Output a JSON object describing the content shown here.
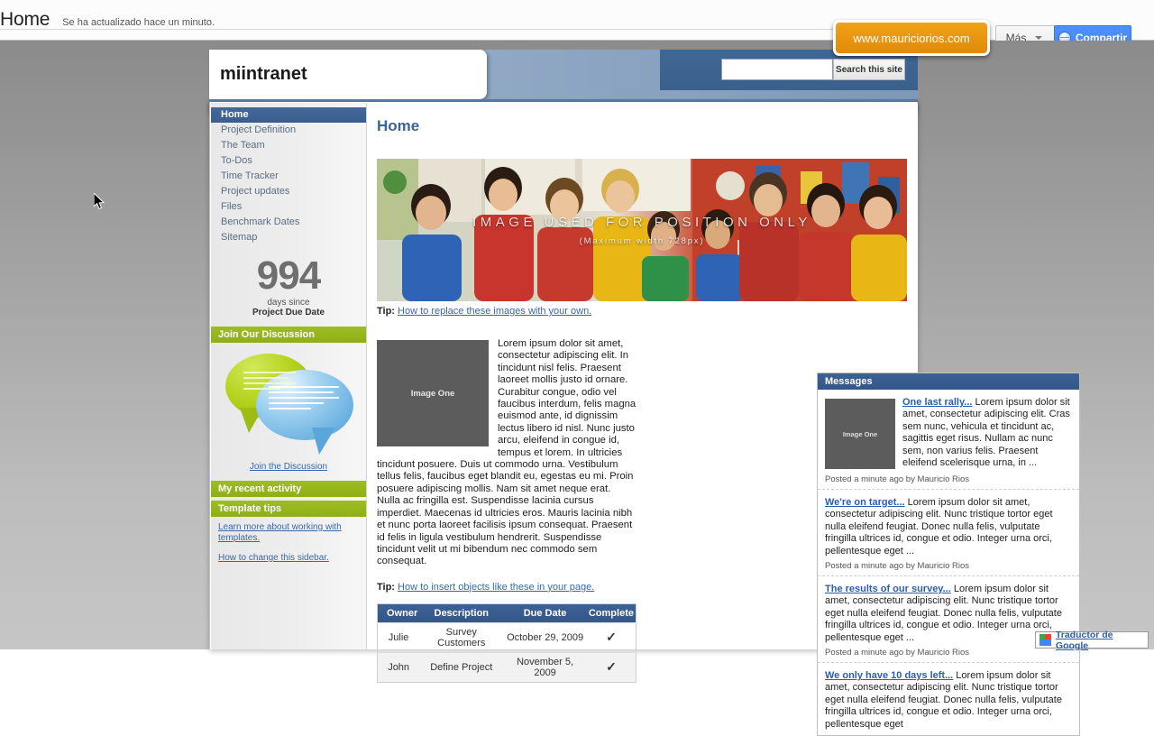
{
  "gbar": {
    "title": "Home",
    "updated": "Se ha actualizado hace un minuto.",
    "more_label": "Más",
    "share_label": "Compartir"
  },
  "overlay": {
    "tooltip_text": "www.mauriciorios.com",
    "tooltip_color": "#e8920d"
  },
  "site": {
    "logo": "miintranet",
    "search_placeholder": "",
    "search_value": "",
    "search_button": "Search this site"
  },
  "sidebar": {
    "nav": [
      {
        "label": "Home",
        "active": true
      },
      {
        "label": "Project Definition",
        "active": false
      },
      {
        "label": "The Team",
        "active": false
      },
      {
        "label": "To-Dos",
        "active": false
      },
      {
        "label": "Time Tracker",
        "active": false
      },
      {
        "label": "Project updates",
        "active": false
      },
      {
        "label": "Files",
        "active": false
      },
      {
        "label": "Benchmark Dates",
        "active": false
      },
      {
        "label": "Sitemap",
        "active": false
      }
    ],
    "counter": {
      "number": "994",
      "line1": "days since",
      "line2": "Project Due Date"
    },
    "discussion_header": "Join Our Discussion",
    "discussion_link": "Join the Discussion",
    "recent_activity_header": "My recent activity",
    "template_tips_header": "Template tips",
    "tip_link_1": "Learn more about working with templates.",
    "tip_link_2": "How to change this sidebar."
  },
  "content": {
    "page_title": "Home",
    "hero": {
      "overlay_line1": "IMAGE USED FOR POSITION ONLY",
      "overlay_line2": "(Maximum width 728px)"
    },
    "tip1_prefix": "Tip:",
    "tip1_link": "How to replace these images with your own.",
    "tip1_suffix": ".",
    "image_one_label": "Image One",
    "body_text": "Lorem ipsum dolor sit amet, consectetur adipiscing elit. In tincidunt nisl felis. Praesent laoreet mollis justo id ornare. Curabitur congue, odio vel faucibus interdum, felis magna euismod ante, id dignissim lectus libero id nisl. Nunc justo arcu, eleifend in congue id, tempus et lorem. In ultricies tincidunt posuere. Duis ut commodo urna. Vestibulum tellus felis, faucibus eget blandit eu, egestas eu mi. Proin posuere adipiscing mollis. Nam sit amet neque erat. Nulla ac fringilla est. Suspendisse lacinia cursus imperdiet. Maecenas id ultricies eros. Mauris lacinia nibh et nunc porta laoreet facilisis ipsum consequat. Praesent id felis in ligula vestibulum hendrerit. Suspendisse tincidunt velit ut mi bibendum nec commodo sem consequat.",
    "tip2_prefix": "Tip:",
    "tip2_link": "How to insert objects like these in your page.",
    "table": {
      "columns": [
        "Owner",
        "Description",
        "Due Date",
        "Complete"
      ],
      "rows": [
        {
          "owner": "Julie",
          "description": "Survey Customers",
          "due": "October 29, 2009",
          "complete": "✓"
        },
        {
          "owner": "John",
          "description": "Define Project",
          "due": "November 5, 2009",
          "complete": "✓"
        }
      ]
    }
  },
  "messages": {
    "header": "Messages",
    "thumb_label": "Image One",
    "items": [
      {
        "title": "One last rally...",
        "body": " Lorem ipsum dolor sit amet, consectetur adipiscing elit. Cras sem nunc, vehicula et tincidunt ac, sagittis eget risus. Nullam ac nunc sem, non varius felis. Praesent eleifend scelerisque urna, in ...",
        "meta": "Posted a minute ago by Mauricio Rios",
        "has_thumb": true
      },
      {
        "title": "We're on target...",
        "body": " Lorem ipsum dolor sit amet, consectetur adipiscing elit. Nunc tristique tortor eget nulla eleifend feugiat. Donec nulla felis, vulputate fringilla ultrices id, congue et odio. Integer urna orci, pellentesque eget ...",
        "meta": "Posted a minute ago by Mauricio Rios",
        "has_thumb": false
      },
      {
        "title": "The results of our survey...",
        "body": " Lorem ipsum dolor sit amet, consectetur adipiscing elit. Nunc tristique tortor eget nulla eleifend feugiat. Donec nulla felis, vulputate fringilla ultrices id, congue et odio. Integer urna orci, pellentesque eget ...",
        "meta": "Posted a minute ago by Mauricio Rios",
        "has_thumb": false
      },
      {
        "title": "We only have 10 days left...",
        "body": " Lorem ipsum dolor sit amet, consectetur adipiscing elit. Nunc tristique tortor eget nulla eleifend feugiat. Donec nulla felis, vulputate fringilla ultrices id, congue et odio. Integer urna orci, pellentesque eget",
        "meta": "",
        "has_thumb": false
      }
    ]
  },
  "translate": {
    "label": "Traductor de Google"
  }
}
